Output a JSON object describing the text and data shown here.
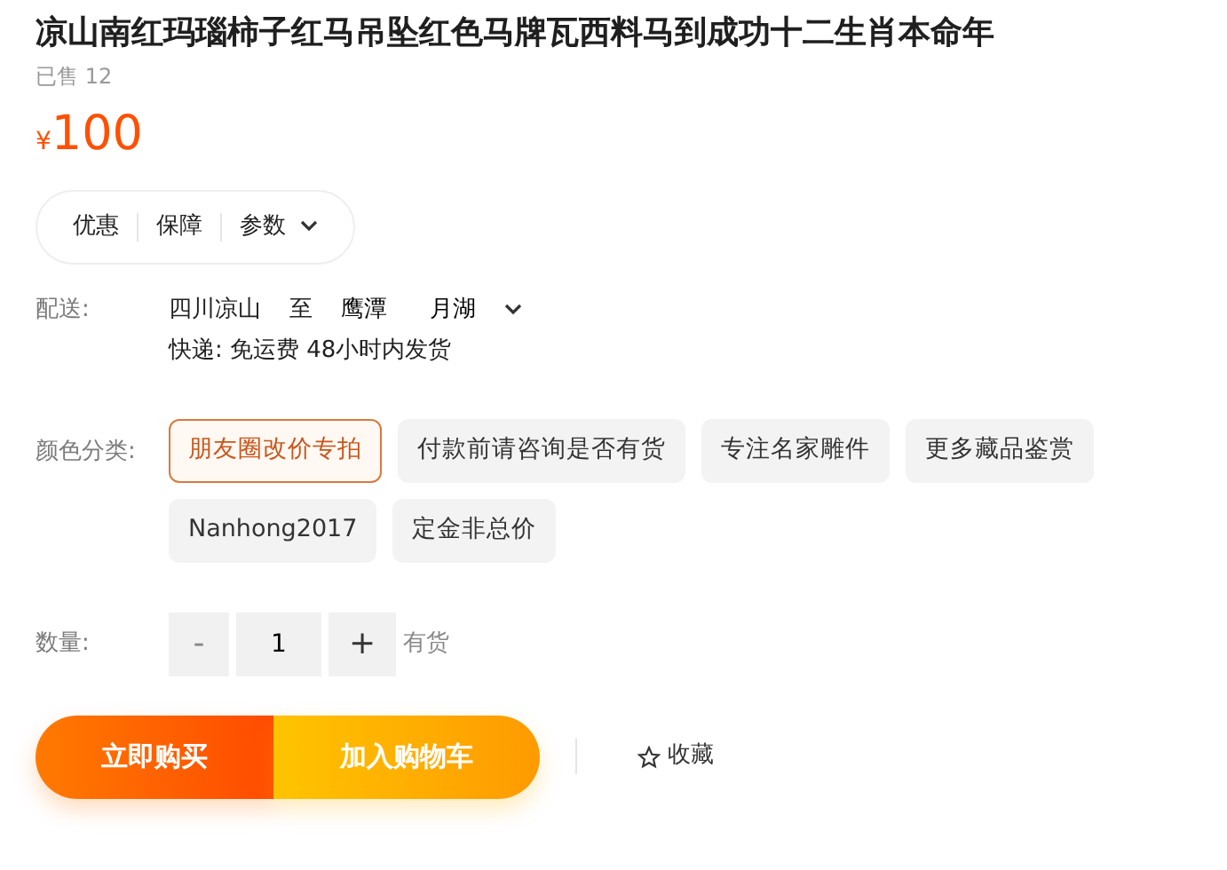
{
  "title": "凉山南红玛瑙柿子红马吊坠红色马牌瓦西料马到成功十二生肖本命年",
  "sold": "已售 12",
  "price": {
    "currency": "¥",
    "amount": "100"
  },
  "info_tabs": [
    {
      "label": "优惠"
    },
    {
      "label": "保障"
    },
    {
      "label": "参数",
      "dropdown": true
    }
  ],
  "delivery": {
    "label": "配送:",
    "from": "四川凉山",
    "to_word": "至",
    "city": "鹰潭",
    "district": "月湖",
    "note": "快递: 免运费  48小时内发货"
  },
  "options": {
    "label": "颜色分类:",
    "items": [
      {
        "label": "朋友圈改价专拍",
        "selected": true
      },
      {
        "label": "付款前请咨询是否有货",
        "selected": false
      },
      {
        "label": "专注名家雕件",
        "selected": false
      },
      {
        "label": "更多藏品鉴赏",
        "selected": false
      },
      {
        "label": "Nanhong2017",
        "selected": false
      },
      {
        "label": "定金非总价",
        "selected": false
      }
    ]
  },
  "quantity": {
    "label": "数量:",
    "minus": "-",
    "minus_disabled": true,
    "value": "1",
    "plus": "+",
    "stock": "有货"
  },
  "buy_now": "立即购买",
  "add_to_cart": "加入购物车",
  "favorite": "收藏"
}
